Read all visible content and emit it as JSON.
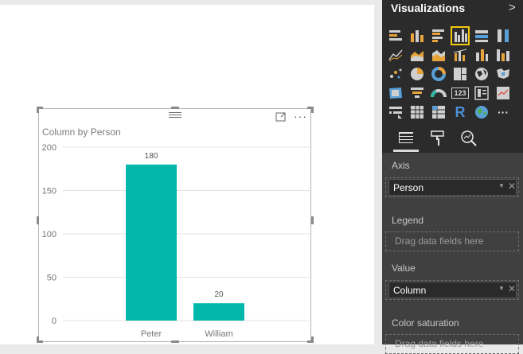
{
  "chart": {
    "title": "Column by Person",
    "more_label": "···"
  },
  "chart_data": {
    "type": "bar",
    "title": "Column by Person",
    "categories": [
      "Peter",
      "William"
    ],
    "values": [
      180,
      20
    ],
    "data_labels": [
      "180",
      "20"
    ],
    "y_ticks": [
      "0",
      "50",
      "100",
      "150",
      "200"
    ],
    "ylim": [
      0,
      200
    ],
    "grid": true,
    "color": "#01b8aa"
  },
  "pane": {
    "title": "Visualizations",
    "chevron": ">",
    "icons": [
      "stacked-bar-icon",
      "stacked-column-icon",
      "clustered-bar-icon",
      "clustered-column-icon",
      "100-stacked-bar-icon",
      "100-stacked-column-icon",
      "line-chart-icon",
      "area-chart-icon",
      "stacked-area-icon",
      "line-column-icon",
      "line-stacked-column-icon",
      "ribbon-chart-icon",
      "scatter-chart-icon",
      "pie-chart-icon",
      "donut-chart-icon",
      "treemap-icon",
      "map-icon",
      "filled-map-icon",
      "shape-map-icon",
      "funnel-icon",
      "gauge-icon",
      "card-icon",
      "multi-row-card-icon",
      "kpi-icon",
      "slicer-icon",
      "table-icon",
      "matrix-icon",
      "r-visual-icon",
      "globe-icon",
      "more-icon"
    ],
    "selected_icon": "clustered-column-icon",
    "card_label": "123",
    "r_label": "R",
    "more_label": "···"
  },
  "wells": {
    "axis": {
      "label": "Axis",
      "field": "Person"
    },
    "legend": {
      "label": "Legend",
      "placeholder": "Drag data fields here"
    },
    "value": {
      "label": "Value",
      "field": "Column"
    },
    "color_saturation": {
      "label": "Color saturation",
      "placeholder": "Drag data fields here"
    },
    "remove_glyph": "✕",
    "caret_glyph": "▼"
  },
  "colors": {
    "accent": "#01b8aa",
    "pane_bg": "#3b3b3b",
    "selected_outline": "#f2c811"
  }
}
